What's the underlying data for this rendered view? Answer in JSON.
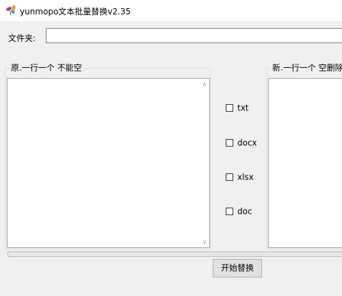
{
  "window": {
    "title": "yunmopo文本批量替换v2.35",
    "icon": "flower-app-icon"
  },
  "folder": {
    "label": "文件夹:",
    "value": "",
    "placeholder": ""
  },
  "original": {
    "group_label": "原.一行一个 不能空",
    "value": ""
  },
  "replacement": {
    "group_label": "新.一行一个 空删除",
    "value": ""
  },
  "file_types": [
    {
      "label": "txt",
      "checked": false
    },
    {
      "label": "docx",
      "checked": false
    },
    {
      "label": "xlsx",
      "checked": false
    },
    {
      "label": "doc",
      "checked": false
    }
  ],
  "progress": {
    "fraction": 0
  },
  "actions": {
    "start_label": "开始替换"
  },
  "colors": {
    "background": "#f0f0f0",
    "titlebar": "#ffffff",
    "button": "#e1e1e1",
    "progress_fill": "#06b025"
  }
}
